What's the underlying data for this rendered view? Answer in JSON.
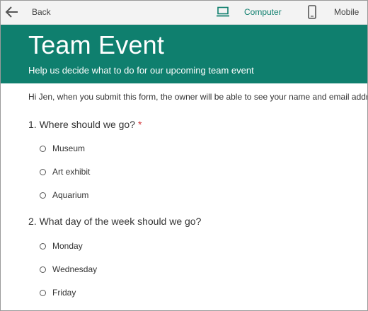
{
  "topbar": {
    "back_label": "Back",
    "computer_label": "Computer",
    "mobile_label": "Mobile"
  },
  "form": {
    "title": "Team Event",
    "subtitle": "Help us decide what to do for our upcoming team event",
    "notice": "Hi Jen, when you submit this form, the owner will be able to see your name and email address."
  },
  "questions": [
    {
      "label": "1. Where should we go?",
      "required_mark": "*",
      "options": [
        "Museum",
        "Art exhibit",
        "Aquarium"
      ]
    },
    {
      "label": "2. What day of the week should we go?",
      "options": [
        "Monday",
        "Wednesday",
        "Friday"
      ]
    }
  ],
  "colors": {
    "accent": "#0f7f6e",
    "required": "#d13438"
  },
  "icons": [
    "back-arrow-icon",
    "computer-icon",
    "mobile-icon",
    "radio-icon"
  ]
}
